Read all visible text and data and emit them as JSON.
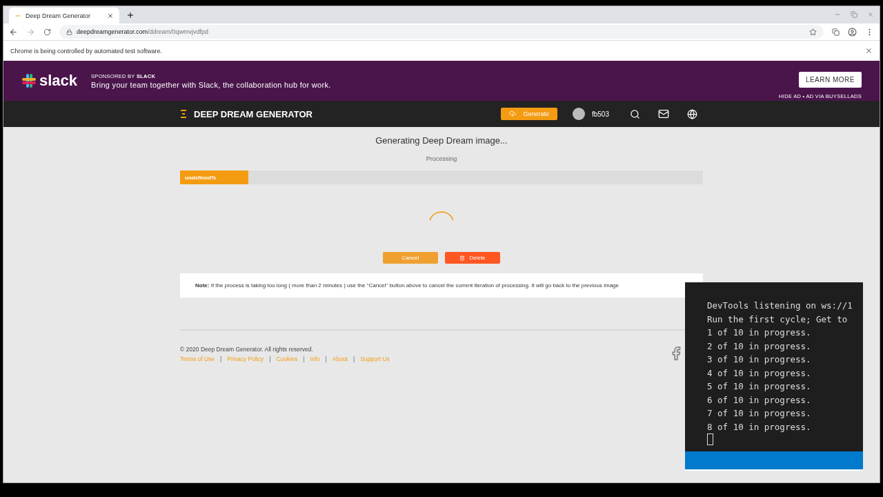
{
  "browser": {
    "tab_title": "Deep Dream Generator",
    "url_host": "deepdreamgenerator.com",
    "url_path": "/ddream/0qwmvjvdfpd",
    "infobar": "Chrome is being controlled by automated test software."
  },
  "ad": {
    "logo": "slack",
    "sponsored": "SPONSORED BY **SLACK**",
    "text": "Bring your team together with Slack, the collaboration hub for work.",
    "button": "LEARN MORE",
    "footnote": "HIDE AD • AD VIA BUYSELLADS"
  },
  "nav": {
    "brand": "DEEP DREAM GENERATOR",
    "generate": "Generate",
    "user": "fb503"
  },
  "progress": {
    "title": "Generating Deep Dream image...",
    "status": "Processing",
    "label": "undefined%",
    "level": 0.13
  },
  "buttons": [
    {
      "label": "Cancel",
      "kind": "cancel"
    },
    {
      "label": "Delete",
      "kind": "delete"
    }
  ],
  "note": "**Note:** If the process is taking too long ( more than 2 minutes ) use the \"Cancel\" button above to cancel the current iteration of processing. It will go back to the previous image",
  "footer": {
    "copyright": "© 2020 Deep Dream Generator. All rights reserved.",
    "separator": "|",
    "links": [
      "Terms of Use",
      "Privacy Policy",
      "Cookies",
      "Info",
      "About",
      "Support Us"
    ]
  },
  "terminal": {
    "lines": [
      "DevTools listening on ws://1",
      "Run the first cycle; Get to",
      "1 of 10 in progress.",
      "2 of 10 in progress.",
      "3 of 10 in progress.",
      "4 of 10 in progress.",
      "5 of 10 in progress.",
      "6 of 10 in progress.",
      "7 of 10 in progress.",
      "8 of 10 in progress."
    ]
  }
}
